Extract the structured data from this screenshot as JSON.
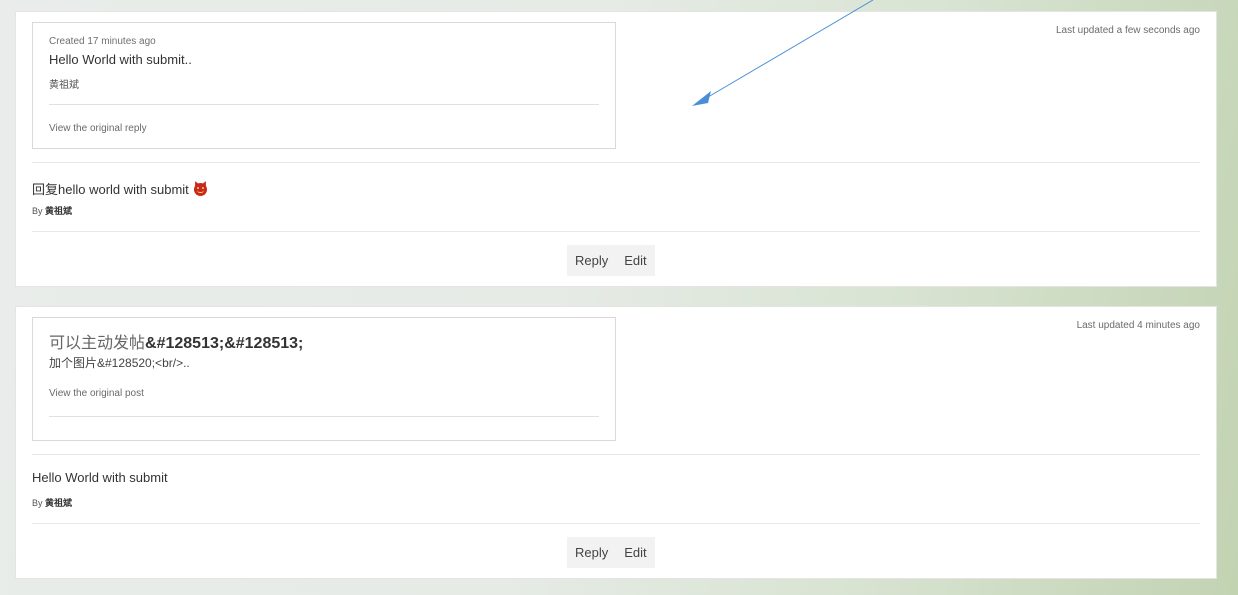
{
  "posts": [
    {
      "updated": "Last updated a few seconds ago",
      "quote": {
        "created": "Created 17 minutes ago",
        "title": "Hello World with submit..",
        "author": "黄祖斌",
        "link": "View the original reply"
      },
      "message": {
        "title": "回复hello world with submit",
        "emoji": "devil-face-icon",
        "by_prefix": "By",
        "author": "黄祖斌"
      },
      "actions": {
        "reply": "Reply",
        "edit": "Edit"
      }
    },
    {
      "updated": "Last updated 4 minutes ago",
      "quote": {
        "title_cjk": "可以主动发帖",
        "title_entities": "&#128513;&#128513;",
        "subtitle": "加个图片&#128520;<br/>..",
        "link": "View the original post"
      },
      "message": {
        "title": "Hello World with submit",
        "by_prefix": "By",
        "author": "黄祖斌"
      },
      "actions": {
        "reply": "Reply",
        "edit": "Edit"
      }
    }
  ],
  "annotation": {
    "color": "#4a8fd6",
    "icon": "annotation-arrow-icon"
  }
}
